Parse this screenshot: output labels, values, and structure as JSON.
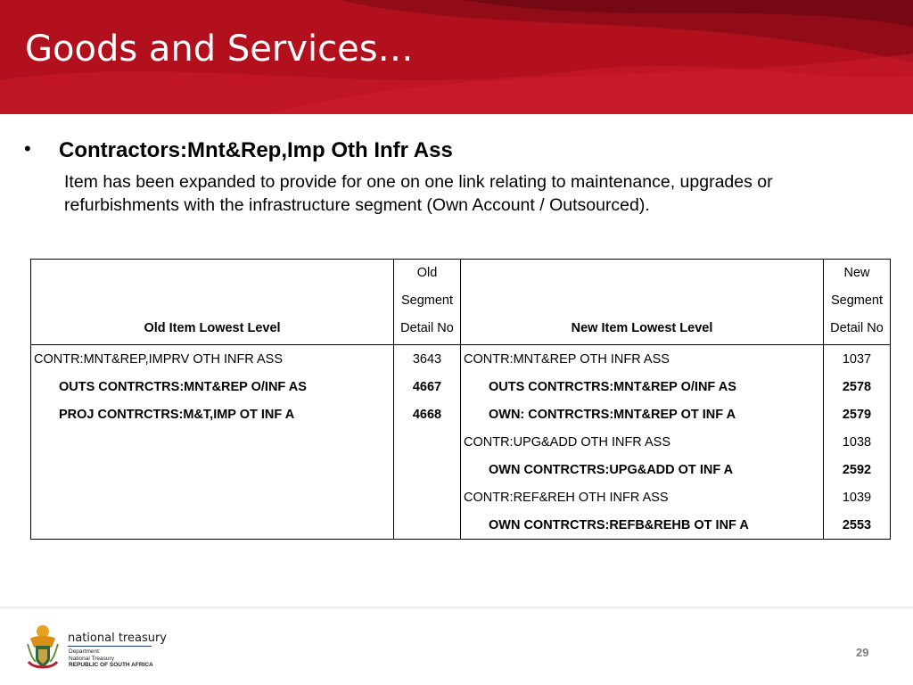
{
  "slide": {
    "title": "Goods and Services…",
    "bullet_heading": "Contractors:Mnt&Rep,Imp Oth Infr Ass",
    "bullet_body": "Item has been expanded to provide for one on one link relating to maintenance, upgrades or refurbishments with the infrastructure segment (Own Account / Outsourced)."
  },
  "table": {
    "headers": {
      "old_item": "Old Item Lowest Level",
      "old_seg_lines": [
        "Old",
        "Segment",
        "Detail No"
      ],
      "new_item": "New Item Lowest Level",
      "new_seg_lines": [
        "New",
        "Segment",
        "Detail No"
      ]
    },
    "rows": [
      {
        "old_item": "CONTR:MNT&REP,IMPRV OTH INFR ASS",
        "old_no": "3643",
        "new_item": "CONTR:MNT&REP OTH INFR ASS",
        "new_no": "1037"
      },
      {
        "old_item": "OUTS CONTRCTRS:MNT&REP O/INF AS",
        "old_no": "4667",
        "new_item": "OUTS CONTRCTRS:MNT&REP O/INF AS",
        "new_no": "2578"
      },
      {
        "old_item": "PROJ CONTRCTRS:M&T,IMP OT INF A",
        "old_no": "4668",
        "new_item": "OWN: CONTRCTRS:MNT&REP OT INF A",
        "new_no": "2579"
      },
      {
        "old_item": "",
        "old_no": "",
        "new_item": "CONTR:UPG&ADD OTH INFR ASS",
        "new_no": "1038"
      },
      {
        "old_item": "",
        "old_no": "",
        "new_item": "OWN CONTRCTRS:UPG&ADD OT INF A",
        "new_no": "2592"
      },
      {
        "old_item": "",
        "old_no": "",
        "new_item": "CONTR:REF&REH OTH INFR ASS",
        "new_no": "1039"
      },
      {
        "old_item": "",
        "old_no": "",
        "new_item": "OWN CONTRCTRS:REFB&REHB OT INF A",
        "new_no": "2553"
      }
    ]
  },
  "footer": {
    "logo_icon": "coat-of-arms-icon",
    "org_name": "national treasury",
    "dept_lines": [
      "Department:",
      "National Treasury",
      "REPUBLIC OF SOUTH AFRICA"
    ],
    "page_number": "29"
  },
  "colors": {
    "banner": "#b3101d",
    "banner_dark": "#7a0a14",
    "page_number": "#7f7f7f"
  }
}
